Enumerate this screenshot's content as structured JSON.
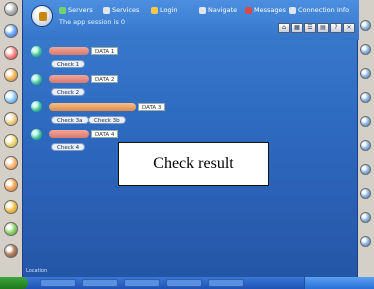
{
  "header": {
    "menu": [
      {
        "label": "Servers",
        "color": "#6fd36f"
      },
      {
        "label": "Services",
        "color": "#e0e6f2"
      },
      {
        "label": "Login",
        "color": "#f2c84a"
      },
      {
        "label": "Navigate",
        "color": "#e0e6f2"
      },
      {
        "label": "Messages",
        "color": "#d94a4a"
      },
      {
        "label": "Connection Info",
        "color": "#e0e6f2"
      }
    ],
    "user_line": "The app session is 0"
  },
  "rows": [
    {
      "tag": "DATA 1",
      "pills": [
        "Check 1"
      ],
      "bar": 0.3
    },
    {
      "tag": "DATA 2",
      "pills": [
        "Check 2"
      ],
      "bar": 0.3
    },
    {
      "tag": "DATA 3",
      "pills": [
        "Check 3a",
        "Check 3b"
      ],
      "bar": 0.65
    },
    {
      "tag": "DATA 4",
      "pills": [
        "Check 4"
      ],
      "bar": 0.3
    }
  ],
  "dialog": {
    "text": "Check result"
  },
  "status": {
    "text": "Location"
  }
}
